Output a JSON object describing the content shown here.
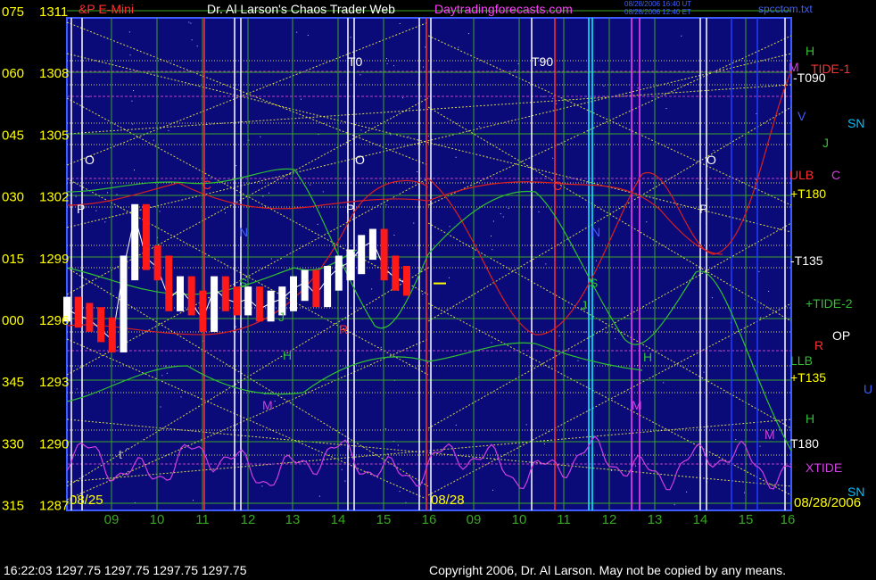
{
  "header": {
    "instrument": "&P E-Mini",
    "title": "Dr. Al Larson's Chaos Trader Web",
    "site": "Daytradingforecasts.com",
    "stamp_lines": [
      "08/28/2006 16:40 UT",
      "08/28/2006 12:40 ET"
    ],
    "file": "spcctom.txt"
  },
  "footer": {
    "status": "16:22:03  1297.75 1297.75 1297.75 1297.75",
    "copyright": "Copyright 2006, Dr. Al Larson. May not be copied by any means."
  },
  "colors": {
    "background": "#000000",
    "plot_bg": "#0a0a78",
    "grid_green": "#3aa626",
    "diag_yellow": "#d8d84a",
    "price_up": "#ffffff",
    "price_down": "#ff1a1a",
    "tide_red": "#d82020",
    "tide_green": "#30c030",
    "xtide_magenta": "#d040e0",
    "axis_yellow": "#ffff00"
  },
  "chart_data": {
    "type": "line",
    "title": "",
    "x_day_labels": [
      "08/25",
      "08/28",
      "08/28/2006"
    ],
    "x_ticks": [
      "09",
      "10",
      "11",
      "12",
      "13",
      "14",
      "15",
      "16",
      "09",
      "10",
      "11",
      "12",
      "13",
      "14",
      "15",
      "16"
    ],
    "y_left_angles": [
      "075",
      "060",
      "045",
      "030",
      "015",
      "000",
      "345",
      "330",
      "315"
    ],
    "y_left_prices": [
      "1311",
      "1308",
      "1305",
      "1302",
      "1299",
      "1296",
      "1293",
      "1290",
      "1287"
    ],
    "ylim": [
      1287,
      1311
    ],
    "right_labels": [
      "H",
      "M",
      "TIDE-1",
      "-T090",
      "V",
      "SN",
      "J",
      "ULB",
      "C",
      "+T180",
      "-T135",
      "+TIDE-2",
      "R",
      "OP",
      "LLB",
      "+T135",
      "U",
      "H",
      "M",
      "T180",
      "XTIDE",
      "SN"
    ],
    "in_chart_labels": [
      "T0",
      "T90",
      "O",
      "P",
      "C",
      "N",
      "S",
      "J",
      "H",
      "M",
      "R",
      "t",
      "O",
      "P",
      "O",
      "P",
      "C",
      "N",
      "S",
      "J",
      "H",
      "M"
    ],
    "price_series": {
      "name": "",
      "x_hours": [
        8.5,
        8.75,
        9.0,
        9.25,
        9.5,
        9.75,
        10.0,
        10.25,
        10.5,
        10.75,
        11.0,
        11.25,
        11.5,
        11.75,
        12.0,
        12.25,
        12.5,
        12.75,
        13.0,
        13.25,
        13.5,
        13.75,
        14.0,
        14.25,
        14.5,
        14.75,
        15.0,
        15.25,
        15.5,
        15.75,
        16.0
      ],
      "close": [
        1296.5,
        1296.2,
        1296.0,
        1295.5,
        1295.0,
        1298.5,
        1301.0,
        1299.0,
        1298.5,
        1297.0,
        1297.5,
        1296.8,
        1296.0,
        1297.5,
        1297.0,
        1296.8,
        1297.0,
        1296.5,
        1296.8,
        1297.0,
        1297.5,
        1297.8,
        1297.2,
        1298.0,
        1298.5,
        1298.8,
        1299.5,
        1299.8,
        1298.5,
        1298.0,
        1297.75
      ]
    }
  }
}
